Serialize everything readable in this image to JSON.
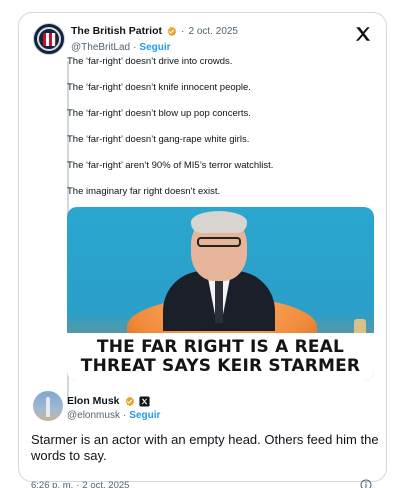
{
  "quoted_post": {
    "author_name": "The British Patriot",
    "date": "2 oct. 2025",
    "handle": "@TheBritLad",
    "follow_label": "Seguir",
    "lines": [
      "The ‘far-right’ doesn’t drive into crowds.",
      "The ‘far-right’ doesn’t knife innocent people.",
      "The ‘far-right’ doesn’t blow up pop concerts.",
      "The ‘far-right’ doesn’t gang-rape white girls.",
      "The ‘far-right’ aren’t 90% of MI5’s terror watchlist.",
      "The imaginary far right doesn’t exist."
    ],
    "media_caption_line1": "THE FAR RIGHT IS A REAL",
    "media_caption_line2": "THREAT SAYS KEIR STARMER"
  },
  "reply_post": {
    "author_name": "Elon Musk",
    "handle": "@elonmusk",
    "follow_label": "Seguir",
    "text": "Starmer is an actor with an empty head. Others feed him the words to say.",
    "time": "6:26 p. m.",
    "date": "2 oct. 2025"
  },
  "icons": {
    "verified": "verified-badge-icon",
    "x_logo": "x-logo-icon",
    "x_affiliate": "x-affiliate-badge-icon",
    "info": "info-icon"
  },
  "colors": {
    "accent": "#1d9bf0",
    "verified": "#e8a52b",
    "muted_text": "#536471",
    "border": "#cfd9de"
  }
}
